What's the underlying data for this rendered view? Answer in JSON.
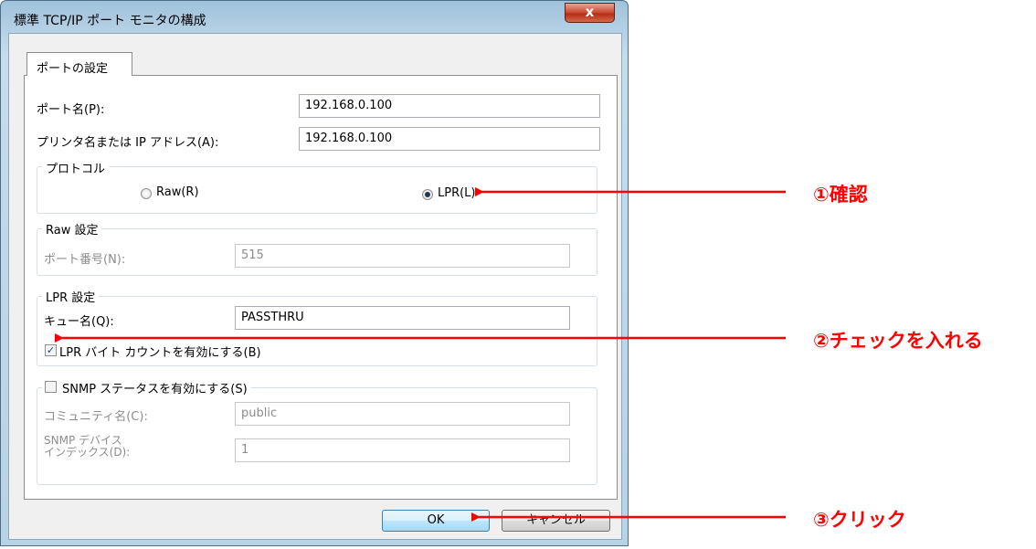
{
  "window": {
    "title": "標準 TCP/IP ポート モニタの構成",
    "close_glyph": "x"
  },
  "tab": {
    "label": "ポートの設定"
  },
  "port_name": {
    "label": "ポート名(P):",
    "value": "192.168.0.100"
  },
  "printer_name": {
    "label": "プリンタ名または IP アドレス(A):",
    "value": "192.168.0.100"
  },
  "protocol": {
    "legend": "プロトコル",
    "raw": {
      "label": "Raw(R)",
      "checked": false
    },
    "lpr": {
      "label": "LPR(L)",
      "checked": true
    }
  },
  "raw_settings": {
    "legend": "Raw 設定",
    "port_number": {
      "label": "ポート番号(N):",
      "value": "515"
    }
  },
  "lpr_settings": {
    "legend": "LPR 設定",
    "queue": {
      "label": "キュー名(Q):",
      "value": "PASSTHRU"
    },
    "byte_count": {
      "label": "LPR バイト カウントを有効にする(B)",
      "checked": true,
      "glyph": "✓"
    }
  },
  "snmp": {
    "label": "SNMP ステータスを有効にする(S)",
    "checked": false,
    "community": {
      "label": "コミュニティ名(C):",
      "value": "public"
    },
    "device_index": {
      "label_line1": "SNMP デバイス",
      "label_line2": "インデックス(D):",
      "value": "1"
    }
  },
  "buttons": {
    "ok": "OK",
    "cancel": "キャンセル"
  },
  "annotations": {
    "a1": "①確認",
    "a2": "②チェックを入れる",
    "a3": "③クリック",
    "color": "#ff0000"
  }
}
